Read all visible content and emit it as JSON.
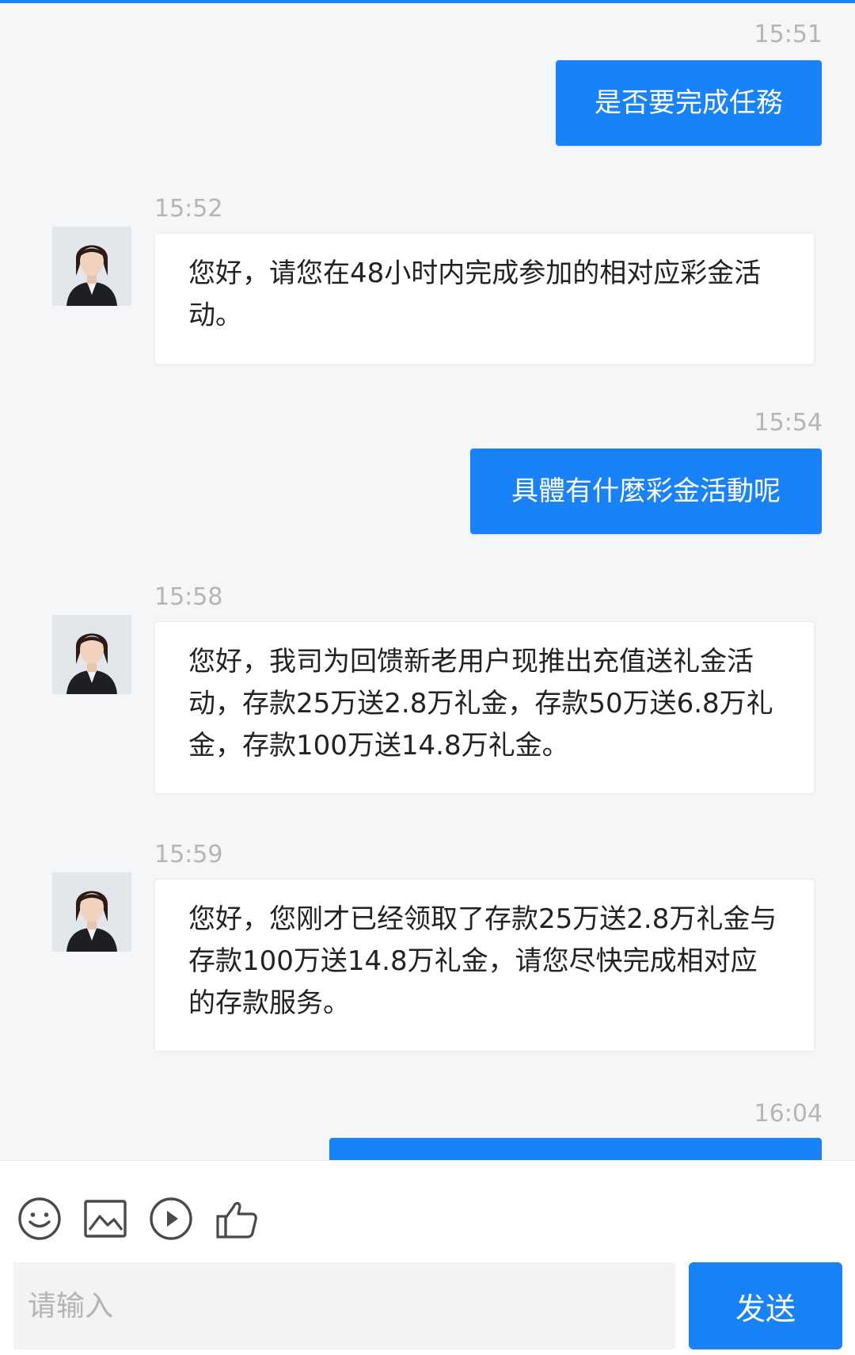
{
  "messages": [
    {
      "time": "15:51",
      "text": "是否要完成任務"
    },
    {
      "time": "15:52",
      "text": "您好，请您在48小时内完成参加的相对应彩金活动。"
    },
    {
      "time": "15:54",
      "text": "具體有什麼彩金活動呢"
    },
    {
      "time": "15:58",
      "text": "您好，我司为回馈新老用户现推出充值送礼金活动，存款25万送2.8万礼金，存款50万送6.8万礼金，存款100万送14.8万礼金。"
    },
    {
      "time": "15:59",
      "text": "您好，您刚才已经领取了存款25万送2.8万礼金与存款100万送14.8万礼金，请您尽快完成相对应的存款服务。"
    },
    {
      "time": "16:04",
      "text": ""
    }
  ],
  "toolbar": {
    "icons": [
      "emoji-icon",
      "image-icon",
      "play-icon",
      "thumbs-up-icon"
    ]
  },
  "composer": {
    "placeholder": "请输入",
    "send_label": "发送"
  },
  "colors": {
    "accent": "#1a82f7",
    "background": "#f5f6f7",
    "timestamp": "#b5b5b5"
  }
}
